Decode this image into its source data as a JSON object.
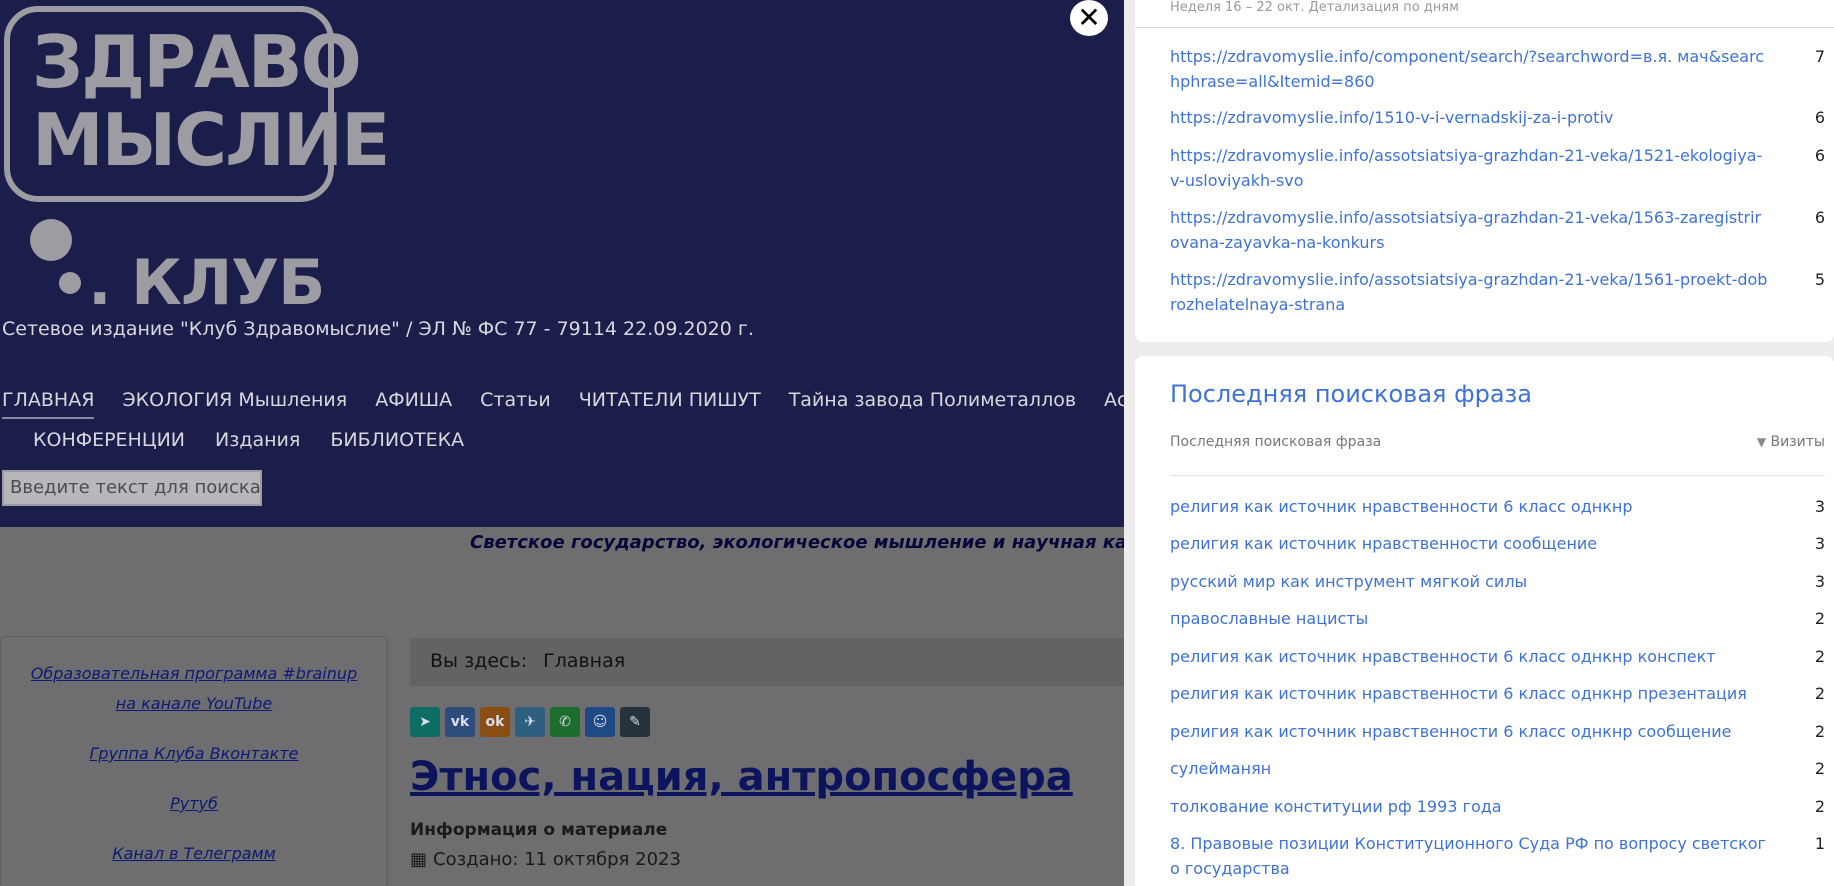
{
  "site": {
    "logo_line1": "ЗДРАВО",
    "logo_line2": "МЫСЛИЕ",
    "logo_club": ". КЛУБ",
    "registration": "Сетевое издание \"Клуб Здравомыслие\" / ЭЛ № ФС 77 - 79114 22.09.2020 г.",
    "nav": [
      "ГЛАВНАЯ",
      "ЭКОЛОГИЯ Мышления",
      "АФИША",
      "Статьи",
      "ЧИТАТЕЛИ ПИШУТ",
      "Тайна завода Полиметаллов",
      "Ассоциация"
    ],
    "nav2": [
      "КОНФЕРЕНЦИИ",
      "Издания",
      "БИБЛИОТЕКА"
    ],
    "search_placeholder": "Введите текст для поиска...",
    "tagline": "Светское государство, экологическое мышление и научная картина мира",
    "sidebar_links": [
      "Образовательная программа #brainup на канале YouTube",
      "Группа Клуба Вконтакте",
      "Рутуб",
      "Канал в Телеграмм"
    ],
    "breadcrumb_label": "Вы здесь:",
    "breadcrumb_home": "Главная",
    "share_icons": [
      "share-icon",
      "vk-icon",
      "ok-icon",
      "telegram-icon",
      "whatsapp-icon",
      "moimir-icon",
      "livejournal-icon"
    ],
    "article_title": "Этнос, нация, антропосфера",
    "info_label": "Информация о материале",
    "created": "Создано: 11 октября 2023"
  },
  "panel": {
    "period": "Неделя 16 – 22 окт. Детализация по дням",
    "pages": [
      {
        "url": "https://zdravomyslie.info/component/search/?searchword=в.я. мач&searchphrase=all&Itemid=860",
        "visits": "7"
      },
      {
        "url": "https://zdravomyslie.info/1510-v-i-vernadskij-za-i-protiv",
        "visits": "6"
      },
      {
        "url": "https://zdravomyslie.info/assotsiatsiya-grazhdan-21-veka/1521-ekologiya-v-usloviyakh-svo",
        "visits": "6"
      },
      {
        "url": "https://zdravomyslie.info/assotsiatsiya-grazhdan-21-veka/1563-zaregistrirovana-zayavka-na-konkurs",
        "visits": "6"
      },
      {
        "url": "https://zdravomyslie.info/assotsiatsiya-grazhdan-21-veka/1561-proekt-dobrozhelatelnaya-strana",
        "visits": "5"
      }
    ],
    "search_section": {
      "title": "Последняя поисковая фраза",
      "col_phrase": "Последняя поисковая фраза",
      "col_visits": "Визиты",
      "rows": [
        {
          "phrase": "религия как источник нравственности 6 класс однкнр",
          "visits": "3"
        },
        {
          "phrase": "религия как источник нравственности сообщение",
          "visits": "3"
        },
        {
          "phrase": "русский мир как инструмент мягкой силы",
          "visits": "3"
        },
        {
          "phrase": "православные нацисты",
          "visits": "2"
        },
        {
          "phrase": "религия как источник нравственности 6 класс однкнр конспект",
          "visits": "2"
        },
        {
          "phrase": "религия как источник нравственности 6 класс однкнр презентация",
          "visits": "2"
        },
        {
          "phrase": "религия как источник нравственности 6 класс однкнр сообщение",
          "visits": "2"
        },
        {
          "phrase": "сулейманян",
          "visits": "2"
        },
        {
          "phrase": "толкование конституции рф 1993 года",
          "visits": "2"
        },
        {
          "phrase": "8. Правовые позиции Конституционного Суда РФ по вопросу светского государства",
          "visits": "1"
        }
      ]
    },
    "close_label": "✕"
  }
}
